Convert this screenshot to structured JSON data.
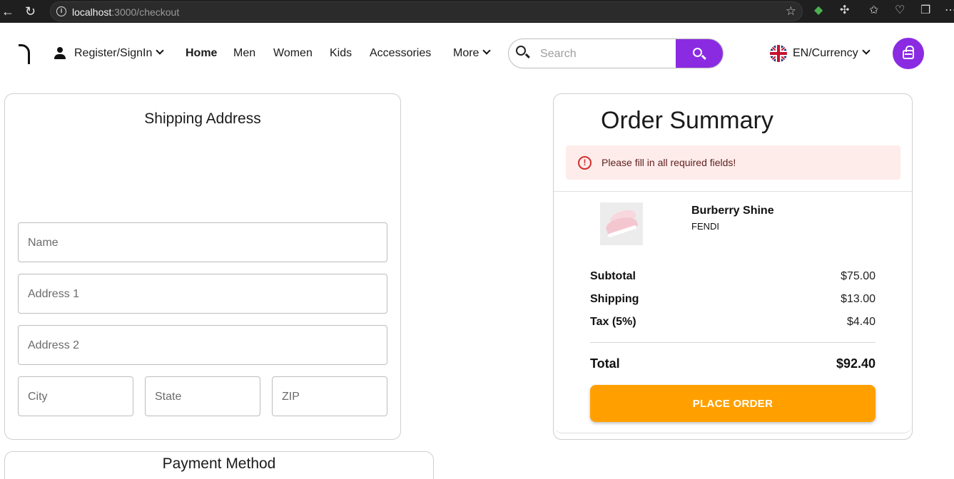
{
  "browser": {
    "url_host": "localhost",
    "url_path": ":3000/checkout"
  },
  "header": {
    "account_label": "Register/SignIn",
    "nav": [
      "Home",
      "Men",
      "Women",
      "Kids",
      "Accessories",
      "More"
    ],
    "search_placeholder": "Search",
    "locale_label": "EN/Currency"
  },
  "shipping": {
    "title": "Shipping Address",
    "fields": {
      "name": "Name",
      "address1": "Address 1",
      "address2": "Address 2",
      "city": "City",
      "state": "State",
      "zip": "ZIP"
    }
  },
  "payment": {
    "title": "Payment Method"
  },
  "summary": {
    "title": "Order Summary",
    "alert": "Please fill in all required fields!",
    "product": {
      "name": "Burberry Shine",
      "brand": "FENDI"
    },
    "subtotal_label": "Subtotal",
    "subtotal": "$75.00",
    "shipping_label": "Shipping",
    "shipping": "$13.00",
    "tax_label": "Tax (5%)",
    "tax": "$4.40",
    "total_label": "Total",
    "total": "$92.40",
    "place_order": "PLACE ORDER"
  },
  "colors": {
    "accent": "#8a2be2",
    "place_order": "#ffa000",
    "alert_bg": "#fdecea",
    "alert_icon": "#d32f2f"
  }
}
